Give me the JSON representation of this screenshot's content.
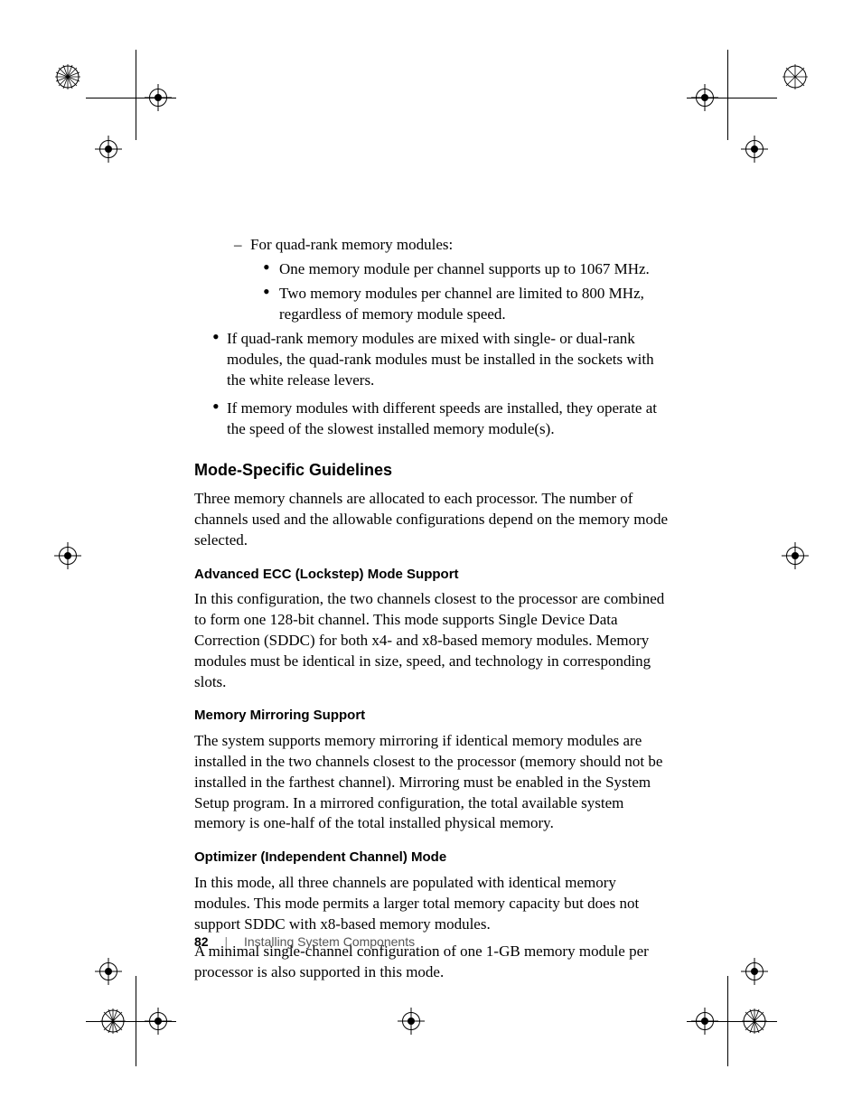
{
  "body": {
    "quad_intro": "For quad-rank memory modules:",
    "quad_sub1": "One memory module per channel supports up to 1067 MHz.",
    "quad_sub2": "Two memory modules per channel are limited to 800 MHz, regardless of memory module speed.",
    "bullet_mixed": "If quad-rank memory modules are mixed with single- or dual-rank modules, the quad-rank modules must be installed in the sockets with the white release levers.",
    "bullet_speeds": "If memory modules with different speeds are installed, they operate at the speed of the slowest installed memory module(s).",
    "h2_mode": "Mode-Specific Guidelines",
    "mode_para": "Three memory channels are allocated to each processor. The number of channels used and the allowable configurations depend on the memory mode selected.",
    "h3_ecc": "Advanced ECC (Lockstep) Mode Support",
    "ecc_para": "In this configuration, the two channels closest to the processor are combined to form one 128-bit channel. This mode supports Single Device Data Correction (SDDC) for both x4- and x8-based memory modules. Memory modules must be identical in size, speed, and technology in corresponding slots.",
    "h3_mirror": "Memory Mirroring Support",
    "mirror_para": "The system supports memory mirroring if identical memory modules are installed in the two channels closest to the processor (memory should not be installed in the farthest channel). Mirroring must be enabled in the System Setup program. In a mirrored configuration, the total available system memory is one-half of the total installed physical memory.",
    "h3_opt": "Optimizer (Independent Channel) Mode",
    "opt_para1": "In this mode, all three channels are populated with identical memory modules. This mode permits a larger total memory capacity but does not support SDDC with x8-based memory modules.",
    "opt_para2": "A minimal single-channel configuration of one 1-GB memory module per processor is also supported in this mode."
  },
  "footer": {
    "page_number": "82",
    "section": "Installing System Components"
  }
}
